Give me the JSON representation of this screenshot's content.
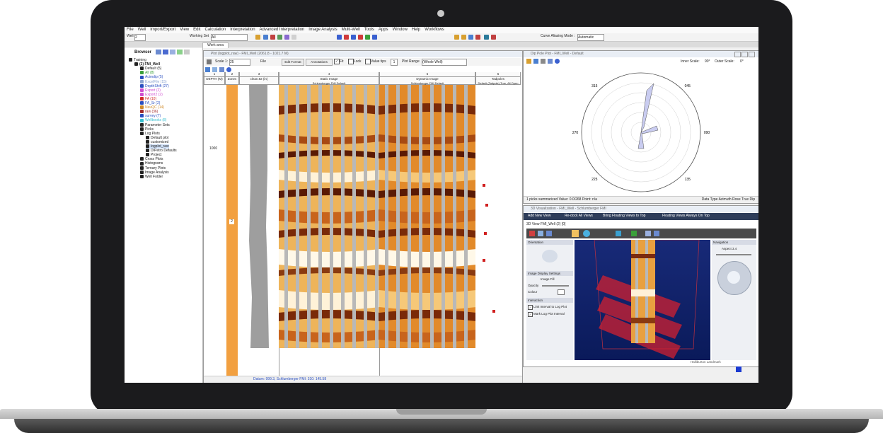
{
  "menu": [
    "File",
    "Well",
    "Import/Export",
    "View",
    "Edit",
    "Calculation",
    "Interpretation",
    "Advanced Interpretation",
    "Image Analysis",
    "Multi-Well",
    "Tools",
    "Apps",
    "Window",
    "Help",
    "Workflows"
  ],
  "toolbar": {
    "well_label": "Well",
    "well_value": "2",
    "working_set_label": "Working Set",
    "working_set_value": "All",
    "curve_aliasing_label": "Curve Aliasing Mode :",
    "curve_aliasing_value": "Automatic"
  },
  "work_tab": "Work area",
  "browser": {
    "title": "Browser",
    "items": [
      {
        "label": "Training",
        "color": "#222222",
        "indent": 0,
        "icon": "folder-icon"
      },
      {
        "label": "(2) FMI_Well",
        "color": "#222222",
        "indent": 1,
        "icon": "well-icon",
        "bold": true
      },
      {
        "label": "Default (5)",
        "color": "#222222",
        "indent": 2,
        "icon": "set-icon"
      },
      {
        "label": "All (8)",
        "color": "#3aa03a",
        "indent": 2,
        "icon": "set-icon"
      },
      {
        "label": "Acimdip (5)",
        "color": "#2a4fc0",
        "indent": 2,
        "icon": "set-icon"
      },
      {
        "label": "ExcelFile (15)",
        "color": "#8aa3d0",
        "indent": 2,
        "icon": "set-icon"
      },
      {
        "label": "DepthShift (27)",
        "color": "#2a4fc0",
        "indent": 2,
        "icon": "set-icon"
      },
      {
        "label": "Export (2)",
        "color": "#d04fd0",
        "indent": 2,
        "icon": "set-icon"
      },
      {
        "label": "Export2 (2)",
        "color": "#d04fd0",
        "indent": 2,
        "icon": "set-icon"
      },
      {
        "label": "FA (10)",
        "color": "#d02a2a",
        "indent": 2,
        "icon": "set-icon"
      },
      {
        "label": "FA_Sr (2)",
        "color": "#2a4fc0",
        "indent": 2,
        "icon": "set-icon"
      },
      {
        "label": "NeuQC (14)",
        "color": "#d08a2a",
        "indent": 2,
        "icon": "set-icon"
      },
      {
        "label": "raw (36)",
        "color": "#a02a2a",
        "indent": 2,
        "icon": "set-icon"
      },
      {
        "label": "survey (7)",
        "color": "#2a4fc0",
        "indent": 2,
        "icon": "set-icon"
      },
      {
        "label": "Wellbooks (8)",
        "color": "#3ac0d0",
        "indent": 2,
        "icon": "set-icon"
      },
      {
        "label": "Parameter Sets",
        "color": "#222222",
        "indent": 2,
        "icon": "parameter-icon"
      },
      {
        "label": "Picks",
        "color": "#222222",
        "indent": 2,
        "icon": "picks-icon"
      },
      {
        "label": "Log Plots",
        "color": "#222222",
        "indent": 2,
        "icon": "logplot-icon"
      },
      {
        "label": "Default plot",
        "color": "#222222",
        "indent": 3,
        "icon": "plot-icon"
      },
      {
        "label": "customized",
        "color": "#222222",
        "indent": 3,
        "icon": "plot-icon"
      },
      {
        "label": "logplot_raw",
        "color": "#222222",
        "indent": 3,
        "icon": "plot-icon",
        "selected": true
      },
      {
        "label": "DIPetro Defaults",
        "color": "#222222",
        "indent": 3,
        "icon": "folder-icon"
      },
      {
        "label": "Project",
        "color": "#222222",
        "indent": 3,
        "icon": "folder-icon"
      },
      {
        "label": "Cross Plots",
        "color": "#222222",
        "indent": 2,
        "icon": "crossplot-icon"
      },
      {
        "label": "Histograms",
        "color": "#222222",
        "indent": 2,
        "icon": "histogram-icon"
      },
      {
        "label": "Ternary Plots",
        "color": "#222222",
        "indent": 2,
        "icon": "ternary-icon"
      },
      {
        "label": "Image Analysis",
        "color": "#222222",
        "indent": 2,
        "icon": "image-icon"
      },
      {
        "label": "Well Folder",
        "color": "#222222",
        "indent": 2,
        "icon": "folder-icon"
      }
    ]
  },
  "logplot": {
    "title": "Plot (logplot_raw) - FMI_Well (2061.8 - 1021.7 M)",
    "scale_label": "Scale 1:",
    "scale_value": "25",
    "file_label": "File",
    "edit_format": "Edit Format",
    "annotations": "Annotations",
    "fit_label": "Fit",
    "lock_label": "Lock",
    "value_tips_label": "Value tips",
    "value_tips_num": "1",
    "plot_range_label": "Plot Range",
    "plot_range_value": "(Whole Well)",
    "headers": [
      {
        "num": "1",
        "title": "DEPTH\n(M)"
      },
      {
        "num": "2",
        "title": "Zones"
      },
      {
        "num": "3",
        "title": "clean.82 (in)"
      },
      {
        "num": "4",
        "title": "Static Image",
        "sub": "Schlumberger FMI\nDefault"
      },
      {
        "num": "5",
        "title": "Dynamic Image",
        "sub": "Schlumberger FMI\nDefault"
      },
      {
        "num": "6",
        "title": "Tadpoles",
        "sub": "Default (Tadpole)\nTrue, All\nOpen Fracture"
      }
    ],
    "depth_tick": "1000",
    "zone_label": "2",
    "status": "Datum: 999.3,  Schlumberger FMI: 310: 145.58"
  },
  "dippole": {
    "title": "Dip Pole Plot - FMI_Well - Default",
    "inner_scale_label": "Inner Scale:",
    "inner_scale_value": "90°",
    "outer_scale_label": "Outer Scale:",
    "outer_scale_value": "0°",
    "compass": [
      "360",
      "045",
      "090",
      "135",
      "180",
      "225",
      "270",
      "315"
    ],
    "status_left": "1 picks summarized  Value: 0.0/268  Point: n/a",
    "status_right": "Data Type  Azimuth Rose  True Dip"
  },
  "viewer3d": {
    "title": "3D Visualization - FMI_Well - Schlumberger FMI",
    "actions": [
      "Add New View",
      "Re-dock All Views",
      "Bring Floating Views to Top",
      "Floating Views Always On Top"
    ],
    "view_tab": "3D View FMI_Well (2) [0]",
    "orientation": "Orientation",
    "image_display": "Image Display Settings",
    "image_fill": "Image Fill",
    "opacity": "Opacity",
    "colour": "Colour",
    "interaction": "Interaction",
    "link_interval": "Link Interval to Log Plot",
    "mark_interval": "Mark Log Plot Interval",
    "navigation": "Navigation",
    "aspect": "Aspect 3.4",
    "brand": "Halliburton Landmark"
  }
}
